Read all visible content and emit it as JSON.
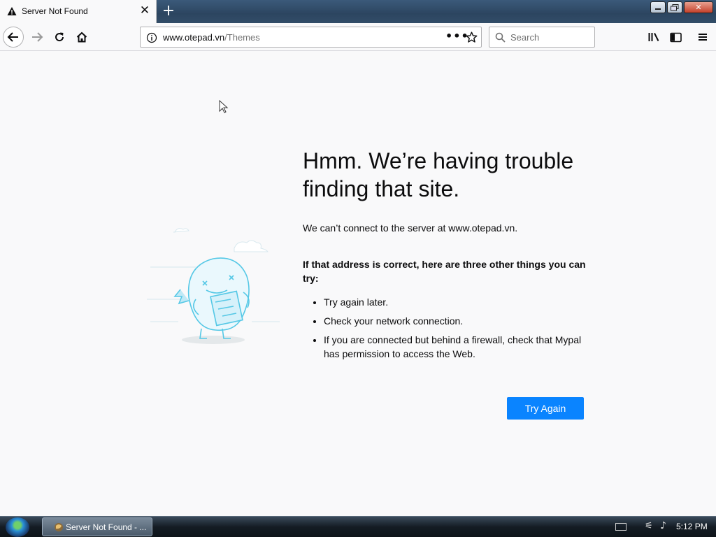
{
  "tab": {
    "title": "Server Not Found",
    "new_tab_symbol": "+"
  },
  "window_buttons": [
    "minimize-icon",
    "restore-icon",
    "close-icon"
  ],
  "navbar": {
    "url_domain": "www.otepad.vn",
    "url_path": "/Themes",
    "page_actions": "•••",
    "search_placeholder": "Search"
  },
  "content": {
    "heading": "Hmm. We’re having trouble finding that site.",
    "description": "We can’t connect to the server at www.otepad.vn.",
    "advice_title": "If that address is correct, here are three other things you can try:",
    "tips": [
      "Try again later.",
      "Check your network connection.",
      "If you are connected but behind a firewall, check that Mypal has permission to access the Web."
    ],
    "try_again_label": "Try Again"
  },
  "taskbar": {
    "task_label": "Server Not Found - ...",
    "clock": "5:12 PM"
  },
  "colors": {
    "accent": "#0a84ff",
    "page_bg": "#f9f9fa",
    "illustration": "#55c8e6"
  }
}
